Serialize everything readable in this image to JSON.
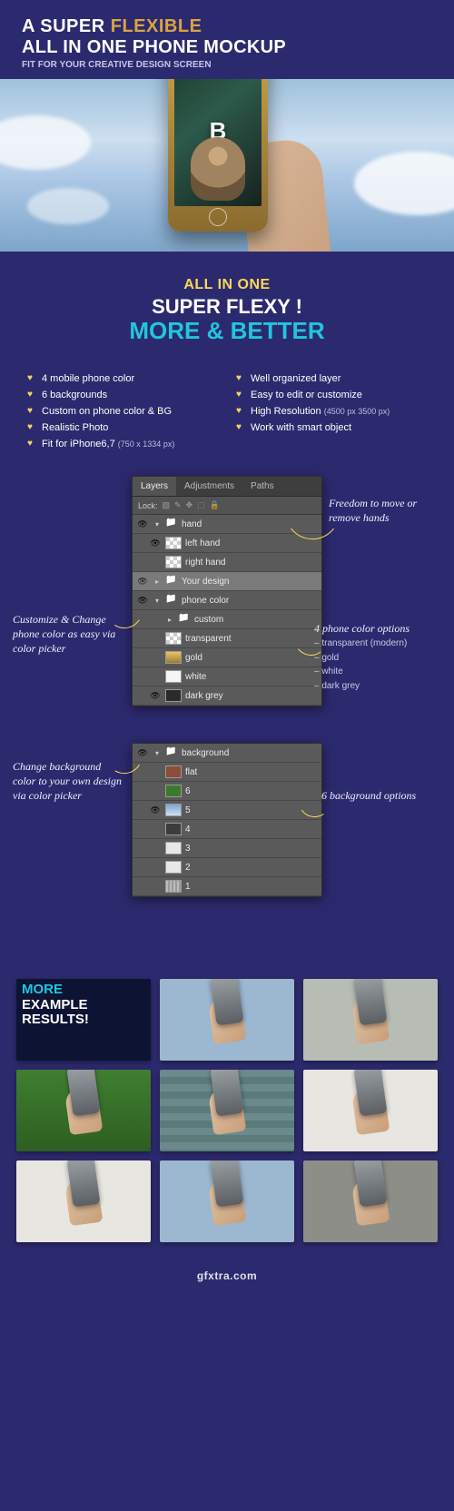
{
  "hero": {
    "line1_a": "A SUPER ",
    "line1_b": "FLEXIBLE",
    "line2": "ALL IN ONE PHONE MOCKUP",
    "line3": "FIT FOR YOUR CREATIVE DESIGN SCREEN",
    "screen_mark": "B"
  },
  "mid": {
    "line1": "ALL IN ONE",
    "line2": "SUPER FLEXY !",
    "line3": "MORE & BETTER"
  },
  "features_left": [
    {
      "text": "4 mobile phone color"
    },
    {
      "text": "6 backgrounds"
    },
    {
      "text": "Custom on phone color & BG"
    },
    {
      "text": "Realistic Photo"
    },
    {
      "text": "Fit for iPhone6,7 ",
      "dim": "(750 x 1334 px)"
    }
  ],
  "features_right": [
    {
      "text": "Well organized layer"
    },
    {
      "text": "Easy to edit or customize"
    },
    {
      "text": "High Resolution ",
      "dim": "(4500 px 3500 px)"
    },
    {
      "text": "Work with smart object"
    }
  ],
  "panel1": {
    "tabs": {
      "layers": "Layers",
      "adjustments": "Adjustments",
      "paths": "Paths"
    },
    "lock_label": "Lock:",
    "rows": {
      "hand": "hand",
      "left_hand": "left hand",
      "right_hand": "right hand",
      "your_design": "Your design",
      "phone_color": "phone color",
      "custom": "custom",
      "transparent": "transparent",
      "gold": "gold",
      "white": "white",
      "dark_grey": "dark grey"
    }
  },
  "panel2": {
    "rows": {
      "background": "background",
      "flat": "flat",
      "n6": "6",
      "n5": "5",
      "n4": "4",
      "n3": "3",
      "n2": "2",
      "n1": "1"
    }
  },
  "annotations": {
    "a1": "Freedom to move or remove hands",
    "a2": "Customize & Change phone color as easy via color picker",
    "a3_title": "4 phone color options",
    "a3_items": [
      "– transparent (modern)",
      "– gold",
      "– white",
      "– dark grey"
    ],
    "a4": "Change background color to your own design via color picker",
    "a5": "6 background options"
  },
  "grid": {
    "head1": "MORE",
    "head2": "EXAMPLE RESULTS!"
  },
  "watermark": "gfxtra.com"
}
